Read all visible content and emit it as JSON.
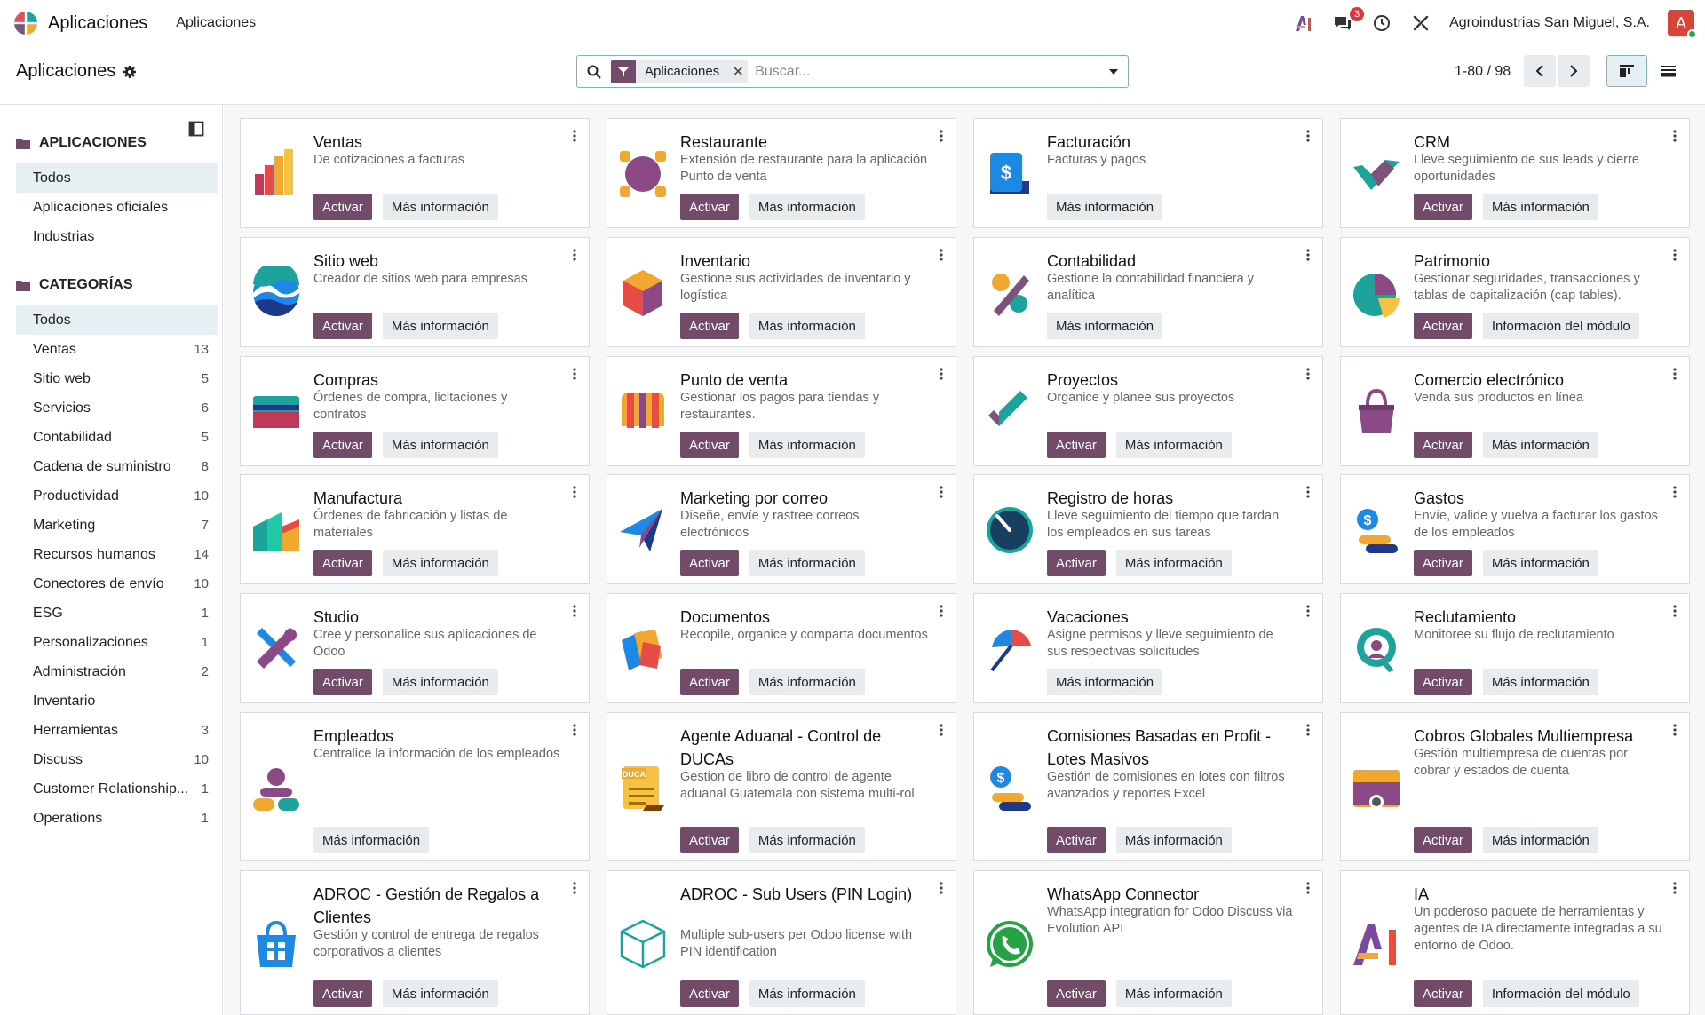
{
  "navbar": {
    "app_title": "Aplicaciones",
    "menu_item": "Aplicaciones",
    "messages_badge": "3",
    "company": "Agroindustrias San Miguel, S.A.",
    "avatar_letter": "A"
  },
  "control_panel": {
    "breadcrumb": "Aplicaciones",
    "facet_label": "Aplicaciones",
    "facet_remove": "✕",
    "search_placeholder": "Buscar...",
    "pager": "1-80 / 98"
  },
  "sidebar": {
    "apps_header": "APLICACIONES",
    "apps_items": [
      {
        "label": "Todos"
      },
      {
        "label": "Aplicaciones oficiales"
      },
      {
        "label": "Industrias"
      }
    ],
    "cat_header": "CATEGORÍAS",
    "cat_items": [
      {
        "label": "Todos",
        "count": ""
      },
      {
        "label": "Ventas",
        "count": "13"
      },
      {
        "label": "Sitio web",
        "count": "5"
      },
      {
        "label": "Servicios",
        "count": "6"
      },
      {
        "label": "Contabilidad",
        "count": "5"
      },
      {
        "label": "Cadena de suministro",
        "count": "8"
      },
      {
        "label": "Productividad",
        "count": "10"
      },
      {
        "label": "Marketing",
        "count": "7"
      },
      {
        "label": "Recursos humanos",
        "count": "14"
      },
      {
        "label": "Conectores de envío",
        "count": "10"
      },
      {
        "label": "ESG",
        "count": "1"
      },
      {
        "label": "Personalizaciones",
        "count": "1"
      },
      {
        "label": "Administración",
        "count": "2"
      },
      {
        "label": "Inventario",
        "count": ""
      },
      {
        "label": "Herramientas",
        "count": "3"
      },
      {
        "label": "Discuss",
        "count": "10"
      },
      {
        "label": "Customer Relationship...",
        "count": "1"
      },
      {
        "label": "Operations",
        "count": "1"
      }
    ]
  },
  "labels": {
    "activate": "Activar",
    "more_info": "Más información",
    "module_info": "Información del módulo"
  },
  "apps": [
    {
      "title": "Ventas",
      "desc": "De cotizaciones a facturas",
      "activate": true,
      "info": "more",
      "icon": "sales-icon"
    },
    {
      "title": "Restaurante",
      "desc": "Extensión de restaurante para la aplicación Punto de venta",
      "activate": true,
      "info": "more",
      "icon": "restaurant-icon"
    },
    {
      "title": "Facturación",
      "desc": "Facturas y pagos",
      "activate": false,
      "info": "more",
      "icon": "invoicing-icon"
    },
    {
      "title": "CRM",
      "desc": "Lleve seguimiento de sus leads y cierre oportunidades",
      "activate": true,
      "info": "more",
      "icon": "crm-icon"
    },
    {
      "title": "Sitio web",
      "desc": "Creador de sitios web para empresas",
      "activate": true,
      "info": "more",
      "icon": "website-icon"
    },
    {
      "title": "Inventario",
      "desc": "Gestione sus actividades de inventario y logística",
      "activate": true,
      "info": "more",
      "icon": "inventory-icon"
    },
    {
      "title": "Contabilidad",
      "desc": "Gestione la contabilidad financiera y analítica",
      "activate": false,
      "info": "more",
      "icon": "accounting-icon"
    },
    {
      "title": "Patrimonio",
      "desc": "Gestionar seguridades, transacciones y tablas de capitalización (cap tables).",
      "activate": true,
      "info": "module",
      "icon": "equity-icon"
    },
    {
      "title": "Compras",
      "desc": "Órdenes de compra, licitaciones y contratos",
      "activate": true,
      "info": "more",
      "icon": "purchase-icon"
    },
    {
      "title": "Punto de venta",
      "desc": "Gestionar los pagos para tiendas y restaurantes.",
      "activate": true,
      "info": "more",
      "icon": "pos-icon"
    },
    {
      "title": "Proyectos",
      "desc": "Organice y planee sus proyectos",
      "activate": true,
      "info": "more",
      "icon": "project-icon"
    },
    {
      "title": "Comercio electrónico",
      "desc": "Venda sus productos en línea",
      "activate": true,
      "info": "more",
      "icon": "ecommerce-icon"
    },
    {
      "title": "Manufactura",
      "desc": "Órdenes de fabricación y listas de materiales",
      "activate": true,
      "info": "more",
      "icon": "manufacturing-icon"
    },
    {
      "title": "Marketing por correo",
      "desc": "Diseñe, envíe y rastree correos electrónicos",
      "activate": true,
      "info": "more",
      "icon": "email-marketing-icon"
    },
    {
      "title": "Registro de horas",
      "desc": "Lleve seguimiento del tiempo que tardan los empleados en sus tareas",
      "activate": true,
      "info": "more",
      "icon": "timesheet-icon"
    },
    {
      "title": "Gastos",
      "desc": "Envíe, valide y vuelva a facturar los gastos de los empleados",
      "activate": true,
      "info": "more",
      "icon": "expenses-icon"
    },
    {
      "title": "Studio",
      "desc": "Cree y personalice sus aplicaciones de Odoo",
      "activate": true,
      "info": "more",
      "icon": "studio-icon"
    },
    {
      "title": "Documentos",
      "desc": "Recopile, organice y comparta documentos",
      "activate": true,
      "info": "more",
      "icon": "documents-icon"
    },
    {
      "title": "Vacaciones",
      "desc": "Asigne permisos y lleve seguimiento de sus respectivas solicitudes",
      "activate": false,
      "info": "more",
      "icon": "time-off-icon"
    },
    {
      "title": "Reclutamiento",
      "desc": "Monitoree su flujo de reclutamiento",
      "activate": true,
      "info": "more",
      "icon": "recruitment-icon"
    },
    {
      "title": "Empleados",
      "desc": "Centralice la información de los empleados",
      "activate": false,
      "info": "more",
      "icon": "employees-icon"
    },
    {
      "title": "Agente Aduanal - Control de DUCAs",
      "desc": "Gestion de libro de control de agente aduanal Guatemala con sistema multi-rol",
      "activate": true,
      "info": "more",
      "icon": "duca-icon"
    },
    {
      "title": "Comisiones Basadas en Profit - Lotes Masivos",
      "desc": "Gestión de comisiones en lotes con filtros avanzados y reportes Excel",
      "activate": true,
      "info": "more",
      "icon": "commissions-icon"
    },
    {
      "title": "Cobros Globales Multiempresa",
      "desc": "Gestión multiempresa de cuentas por cobrar y estados de cuenta",
      "activate": true,
      "info": "more",
      "icon": "collections-icon"
    },
    {
      "title": "ADROC - Gestión de Regalos a Clientes",
      "desc": "Gestión y control de entrega de regalos corporativos a clientes",
      "activate": true,
      "info": "more",
      "icon": "gift-bag-icon"
    },
    {
      "title": "ADROC - Sub Users (PIN Login)",
      "desc": "Multiple sub-users per Odoo license with PIN identification",
      "activate": true,
      "info": "more",
      "icon": "cube-icon"
    },
    {
      "title": "WhatsApp Connector",
      "desc": "WhatsApp integration for Odoo Discuss via Evolution API",
      "activate": true,
      "info": "more",
      "icon": "whatsapp-icon"
    },
    {
      "title": "IA",
      "desc": "Un poderoso paquete de herramientas y agentes de IA directamente integradas a su entorno de Odoo.",
      "activate": true,
      "info": "module",
      "icon": "ai-icon"
    }
  ]
}
